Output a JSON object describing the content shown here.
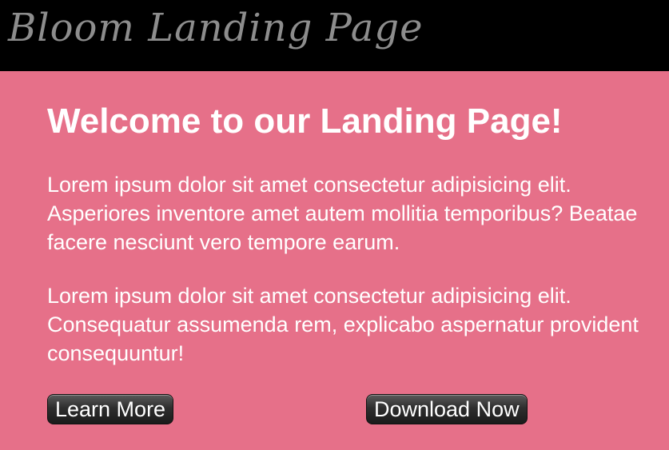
{
  "header": {
    "logo_text": "Bloom Landing Page"
  },
  "main": {
    "title": "Welcome to our Landing Page!",
    "paragraphs": [
      "Lorem ipsum dolor sit amet consectetur adipisicing elit. Asperiores inventore amet autem mollitia temporibus? Beatae facere nesciunt vero tempore earum.",
      "Lorem ipsum dolor sit amet consectetur adipisicing elit. Consequatur assumenda rem, explicabo aspernatur provident consequuntur!"
    ],
    "buttons": {
      "learn_more": "Learn More",
      "download_now": "Download Now"
    }
  },
  "colors": {
    "background": "#e67089",
    "header_background": "#000000",
    "logo_text": "#8d8d8d",
    "body_text": "#ffffff",
    "button_background": "#2e2e2e"
  }
}
